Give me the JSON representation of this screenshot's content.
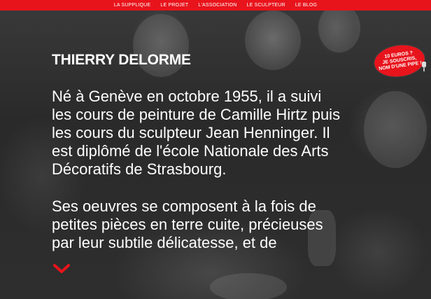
{
  "nav": {
    "items": [
      {
        "label": "LA SUPPLIQUE"
      },
      {
        "label": "LE PROJET"
      },
      {
        "label": "L'ASSOCIATION"
      },
      {
        "label": "LE SCULPTEUR"
      },
      {
        "label": "LE BLOG"
      }
    ],
    "active_index": 3
  },
  "main": {
    "title": "THIERRY DELORME",
    "paragraph1": [
      "Né à Genève en octobre 1955, il a suivi",
      "les cours de peinture de Camille Hirtz puis",
      "les cours du sculpteur Jean Henninger. Il",
      "est diplômé de l'école Nationale des Arts",
      "Décoratifs de Strasbourg."
    ],
    "paragraph2": [
      "Ses oeuvres se composent à la fois de",
      "petites pièces en terre cuite, précieuses",
      "par leur subtile délicatesse, et de"
    ]
  },
  "badge": {
    "line1": "10 EUROS ?",
    "line2": "JE SOUSCRIS,",
    "line3": "NOM D'UNE PIPE !"
  },
  "icons": {
    "scroll": "chevron-down-icon",
    "pipe": "pipe-icon"
  },
  "colors": {
    "accent": "#e8141c",
    "text": "#ffffff"
  }
}
